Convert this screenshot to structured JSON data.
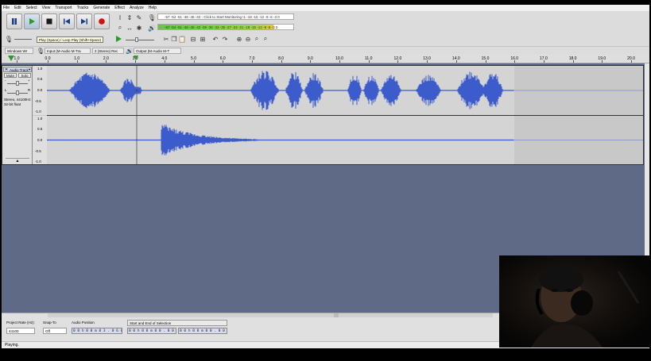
{
  "menu": [
    "File",
    "Edit",
    "Select",
    "View",
    "Transport",
    "Tracks",
    "Generate",
    "Effect",
    "Analyze",
    "Help"
  ],
  "tooltip": "Play (Space) / Loop Play (Shift+Space)",
  "meters": {
    "record_scale": "-57 -54 -51 -48 -45 -42 -  Click to Start Monitoring  !1 -18 -15 -12  -9  -6  -3  0",
    "play_scale": "-57 -54 -51 -48 -45 -42 -39 -36 -33 -30 -27 -24 -21 -18 -15 -12  -9  -6  -3  0"
  },
  "devices": {
    "host": "Windows WI",
    "input": "Input (M-Audio M-Tra",
    "channels": "2 (Stereo) Rec",
    "output": "Output (M-Audio M-T"
  },
  "ruler": {
    "ticks": [
      "1.0",
      "0.0",
      "1.0",
      "2.0",
      "3.0",
      "4.0",
      "5.0",
      "6.0",
      "7.0",
      "8.0",
      "9.0",
      "10.0",
      "11.0",
      "12.0",
      "13.0",
      "14.0",
      "15.0",
      "16.0",
      "17.0",
      "18.0",
      "19.0",
      "20.0"
    ]
  },
  "track": {
    "name": "Audio Track",
    "mute": "Mute",
    "solo": "Solo",
    "info_line1": "Stereo, 44100Hz",
    "info_line2": "32-bit float",
    "gain_minus": "-",
    "gain_plus": "+",
    "pan_left": "L",
    "pan_right": "R",
    "scale": [
      "1.0",
      "0.5",
      "0.0",
      "-0.5",
      "-1.0"
    ]
  },
  "bottom": {
    "rate_label": "Project Rate (Hz):",
    "rate_value": "44100",
    "snap_label": "Snap-To",
    "snap_value": "Off",
    "audio_pos_label": "Audio Position",
    "audio_pos_value": "0 0 h 0 0 m 0 3 . 0 6 0 s",
    "selection_label": "Start and End of Selection",
    "sel_start": "0 0 h 0 0 m 0 0 . 0 0 0 s",
    "sel_end": "0 0 h 0 0 m 0 0 . 0 0 0 s"
  },
  "status": "Playing.",
  "colors": {
    "waveform": "#3c5ccc",
    "track_bg": "#c8c8c8",
    "selected_bg": "#d4d4d4",
    "trackarea_bg": "#5f6a86",
    "record_red": "#cc1111",
    "play_green": "#2a9a2a"
  }
}
